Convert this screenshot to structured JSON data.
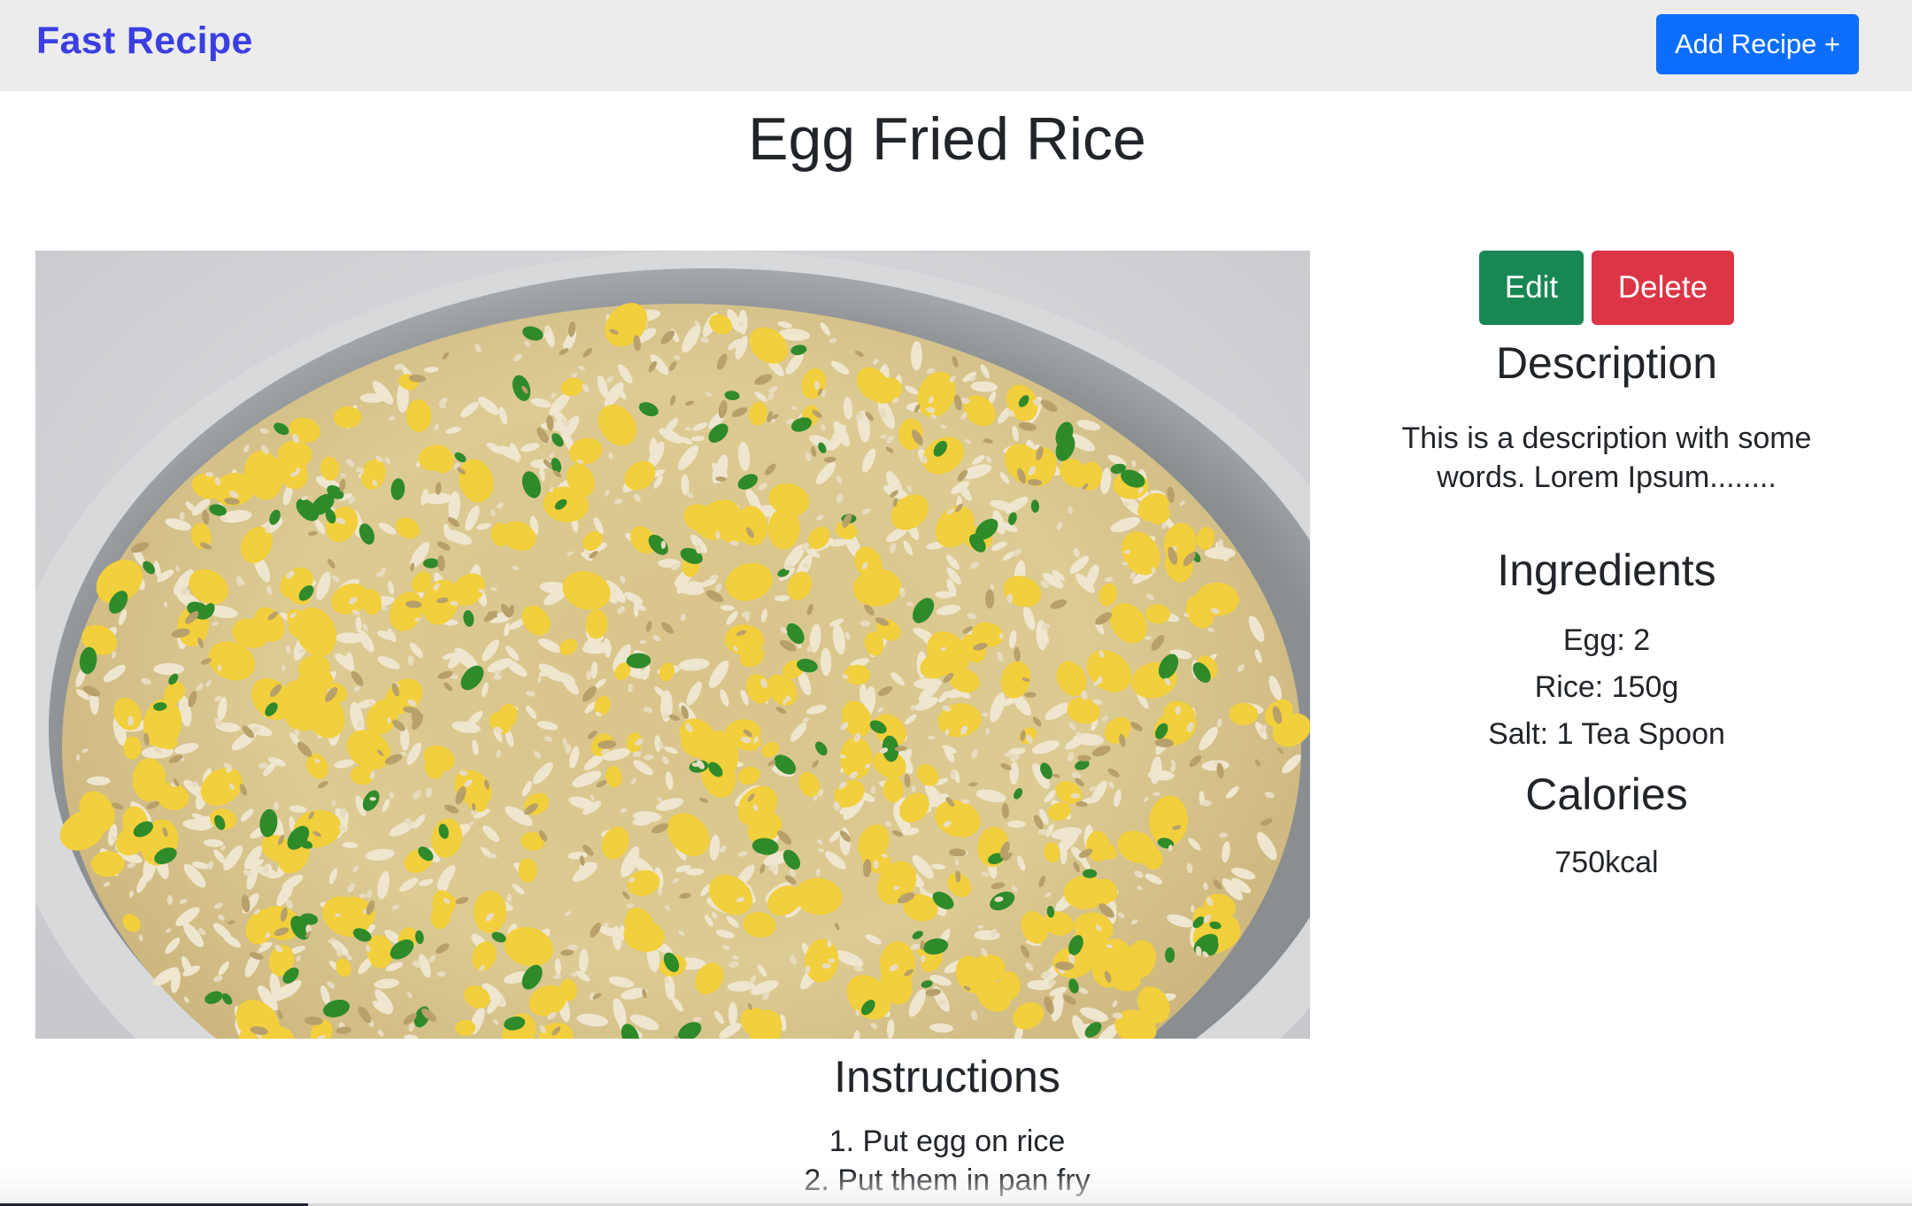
{
  "navbar": {
    "brand": "Fast Recipe",
    "add_button_label": "Add Recipe +",
    "brand_color": "#3b3fe0",
    "button_color": "#0d6efd"
  },
  "recipe": {
    "title": "Egg Fried Rice",
    "image_alt": "Egg fried rice in a grey bowl",
    "edit_label": "Edit",
    "delete_label": "Delete",
    "edit_color": "#198754",
    "delete_color": "#dc3545",
    "description_heading": "Description",
    "description": "This is a description with some words. Lorem Ipsum........",
    "ingredients_heading": "Ingredients",
    "ingredients": [
      "Egg: 2",
      "Rice: 150g",
      "Salt: 1 Tea Spoon"
    ],
    "calories_heading": "Calories",
    "calories": "750kcal",
    "instructions_heading": "Instructions",
    "instructions": [
      "1. Put egg on rice",
      "2. Put them in pan fry"
    ]
  }
}
